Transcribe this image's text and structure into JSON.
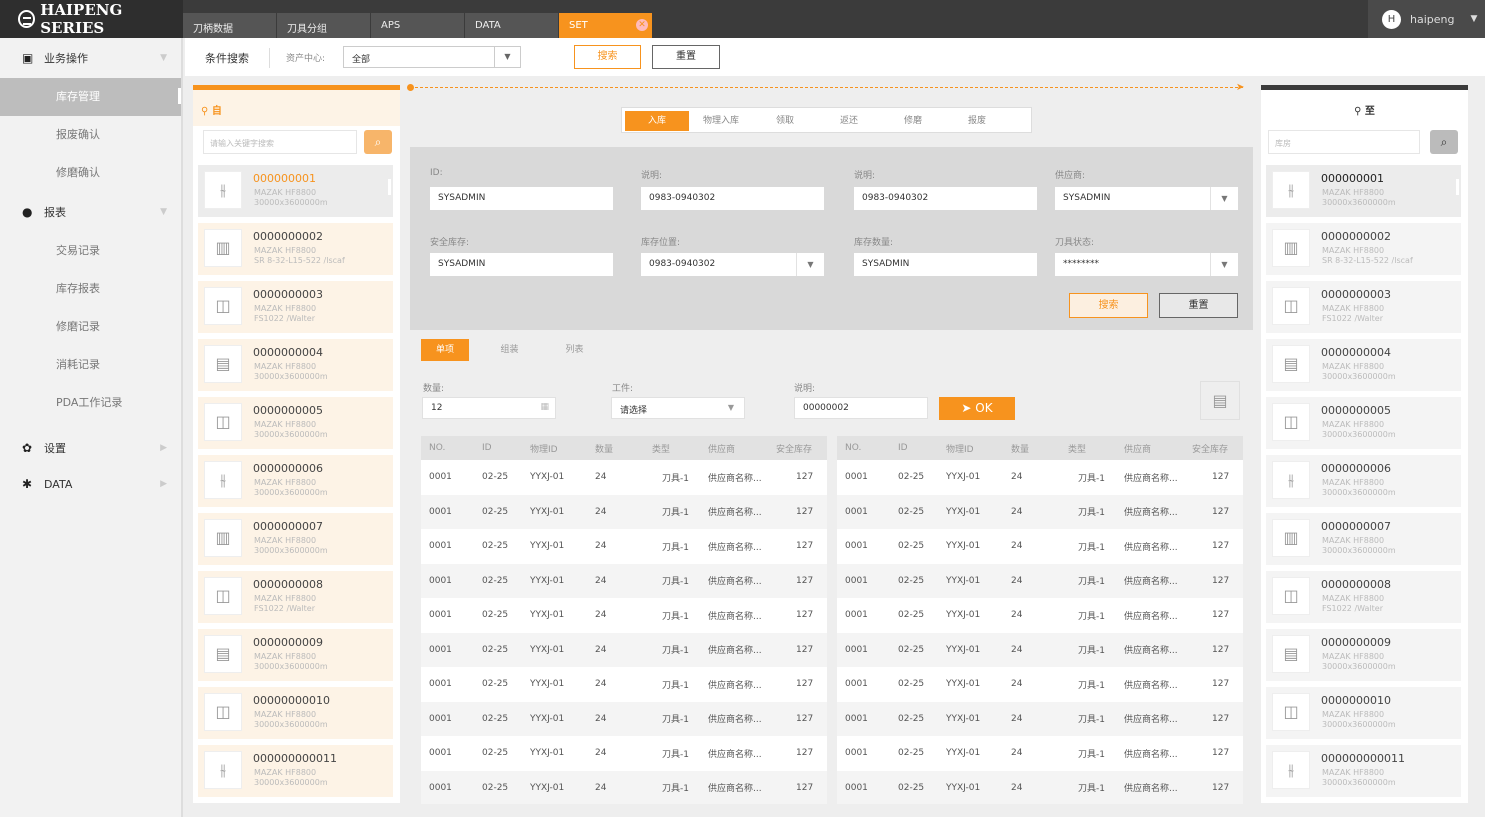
{
  "app": {
    "logo_text": "HAIPENG SERIES"
  },
  "top_tabs": [
    {
      "label": "刀柄数据",
      "active": false
    },
    {
      "label": "刀具分组",
      "active": false
    },
    {
      "label": "APS",
      "active": false
    },
    {
      "label": "DATA",
      "active": false
    },
    {
      "label": "SET",
      "active": true
    }
  ],
  "user": {
    "initial": "H",
    "name": "haipeng"
  },
  "sidebar": {
    "groups": [
      {
        "label": "业务操作",
        "icon": "briefcase-icon",
        "items": [
          "库存管理",
          "报废确认",
          "修磨确认"
        ]
      },
      {
        "label": "报表",
        "icon": "report-icon",
        "items": [
          "交易记录",
          "库存报表",
          "修磨记录",
          "消耗记录",
          "PDA工作记录"
        ]
      },
      {
        "label": "设置",
        "icon": "gear-icon",
        "items": []
      },
      {
        "label": "DATA",
        "icon": "data-icon",
        "items": []
      }
    ],
    "active_item": "库存管理"
  },
  "searchbar": {
    "title": "条件搜索",
    "field_label": "资产中心:",
    "select_value": "全部",
    "search_label": "搜索",
    "reset_label": "重置"
  },
  "left_panel": {
    "title": "自",
    "search_placeholder": "请输入关键字搜索",
    "items": [
      {
        "code": "000000001",
        "l1": "MAZAK HF8800",
        "l2": "30000x3600000m",
        "icon": "drill-icon"
      },
      {
        "code": "0000000002",
        "l1": "MAZAK HF8800",
        "l2": "SR 8-32-L15-522 /lscaf",
        "icon": "holder-icon"
      },
      {
        "code": "0000000003",
        "l1": "MAZAK HF8800",
        "l2": "FS1022 /Walter",
        "icon": "cutter-icon"
      },
      {
        "code": "0000000004",
        "l1": "MAZAK HF8800",
        "l2": "30000x3600000m",
        "icon": "box-icon"
      },
      {
        "code": "0000000005",
        "l1": "MAZAK HF8800",
        "l2": "30000x3600000m",
        "icon": "cutter-icon"
      },
      {
        "code": "0000000006",
        "l1": "MAZAK HF8800",
        "l2": "30000x3600000m",
        "icon": "drill-icon"
      },
      {
        "code": "0000000007",
        "l1": "MAZAK HF8800",
        "l2": "30000x3600000m",
        "icon": "holder-icon"
      },
      {
        "code": "0000000008",
        "l1": "MAZAK HF8800",
        "l2": "FS1022 /Walter",
        "icon": "cutter-icon"
      },
      {
        "code": "0000000009",
        "l1": "MAZAK HF8800",
        "l2": "30000x3600000m",
        "icon": "box-icon"
      },
      {
        "code": "00000000010",
        "l1": "MAZAK HF8800",
        "l2": "30000x3600000m",
        "icon": "cutter-icon"
      },
      {
        "code": "000000000011",
        "l1": "MAZAK HF8800",
        "l2": "30000x3600000m",
        "icon": "drill-icon"
      }
    ]
  },
  "right_panel": {
    "title": "至",
    "search_placeholder": "库房",
    "items": [
      {
        "code": "000000001",
        "l1": "MAZAK HF8800",
        "l2": "30000x3600000m",
        "icon": "drill-icon"
      },
      {
        "code": "0000000002",
        "l1": "MAZAK HF8800",
        "l2": "SR 8-32-L15-522 /lscaf",
        "icon": "holder-icon"
      },
      {
        "code": "0000000003",
        "l1": "MAZAK HF8800",
        "l2": "FS1022 /Walter",
        "icon": "cutter-icon"
      },
      {
        "code": "0000000004",
        "l1": "MAZAK HF8800",
        "l2": "30000x3600000m",
        "icon": "box-icon"
      },
      {
        "code": "0000000005",
        "l1": "MAZAK HF8800",
        "l2": "30000x3600000m",
        "icon": "cutter-icon"
      },
      {
        "code": "0000000006",
        "l1": "MAZAK HF8800",
        "l2": "30000x3600000m",
        "icon": "drill-icon"
      },
      {
        "code": "0000000007",
        "l1": "MAZAK HF8800",
        "l2": "30000x3600000m",
        "icon": "holder-icon"
      },
      {
        "code": "0000000008",
        "l1": "MAZAK HF8800",
        "l2": "FS1022 /Walter",
        "icon": "cutter-icon"
      },
      {
        "code": "0000000009",
        "l1": "MAZAK HF8800",
        "l2": "30000x3600000m",
        "icon": "box-icon"
      },
      {
        "code": "0000000010",
        "l1": "MAZAK HF8800",
        "l2": "30000x3600000m",
        "icon": "cutter-icon"
      },
      {
        "code": "000000000011",
        "l1": "MAZAK HF8800",
        "l2": "30000x3600000m",
        "icon": "drill-icon"
      }
    ]
  },
  "op_tabs": [
    {
      "label": "入库",
      "active": true
    },
    {
      "label": "物理入库",
      "active": false
    },
    {
      "label": "领取",
      "active": false
    },
    {
      "label": "返还",
      "active": false
    },
    {
      "label": "修磨",
      "active": false
    },
    {
      "label": "报废",
      "active": false
    }
  ],
  "form": {
    "id_label": "ID:",
    "id_value": "SYSADMIN",
    "desc1_label": "说明:",
    "desc1_value": "0983-0940302",
    "desc2_label": "说明:",
    "desc2_value": "0983-0940302",
    "supplier_label": "供应商:",
    "supplier_value": "SYSADMIN",
    "safety_label": "安全库存:",
    "safety_value": "SYSADMIN",
    "location_label": "库存位置:",
    "location_value": "0983-0940302",
    "qty_label": "库存数量:",
    "qty_value": "SYSADMIN",
    "status_label": "刀具状态:",
    "status_value": "********",
    "search_label": "搜索",
    "reset_label": "重置"
  },
  "sub_tabs": [
    {
      "label": "单项",
      "active": true
    },
    {
      "label": "组装",
      "active": false
    },
    {
      "label": "列表",
      "active": false
    }
  ],
  "quick": {
    "qty_label": "数量:",
    "qty_value": "12",
    "workpiece_label": "工件:",
    "workpiece_value": "请选择",
    "desc_label": "说明:",
    "desc_value": "00000002",
    "ok_label": "OK"
  },
  "table": {
    "headers": [
      "NO.",
      "ID",
      "物理ID",
      "数量",
      "类型",
      "供应商",
      "安全库存"
    ],
    "rows": [
      [
        "0001",
        "02-25",
        "YYXJ-01",
        "24",
        "刀具-1",
        "供应商名称...",
        "127"
      ],
      [
        "0001",
        "02-25",
        "YYXJ-01",
        "24",
        "刀具-1",
        "供应商名称...",
        "127"
      ],
      [
        "0001",
        "02-25",
        "YYXJ-01",
        "24",
        "刀具-1",
        "供应商名称...",
        "127"
      ],
      [
        "0001",
        "02-25",
        "YYXJ-01",
        "24",
        "刀具-1",
        "供应商名称...",
        "127"
      ],
      [
        "0001",
        "02-25",
        "YYXJ-01",
        "24",
        "刀具-1",
        "供应商名称...",
        "127"
      ],
      [
        "0001",
        "02-25",
        "YYXJ-01",
        "24",
        "刀具-1",
        "供应商名称...",
        "127"
      ],
      [
        "0001",
        "02-25",
        "YYXJ-01",
        "24",
        "刀具-1",
        "供应商名称...",
        "127"
      ],
      [
        "0001",
        "02-25",
        "YYXJ-01",
        "24",
        "刀具-1",
        "供应商名称...",
        "127"
      ],
      [
        "0001",
        "02-25",
        "YYXJ-01",
        "24",
        "刀具-1",
        "供应商名称...",
        "127"
      ],
      [
        "0001",
        "02-25",
        "YYXJ-01",
        "24",
        "刀具-1",
        "供应商名称...",
        "127"
      ]
    ]
  },
  "colors": {
    "accent": "#f7931e",
    "topbar": "#3b3b3b",
    "sidebar_active": "#bdbdbd"
  }
}
